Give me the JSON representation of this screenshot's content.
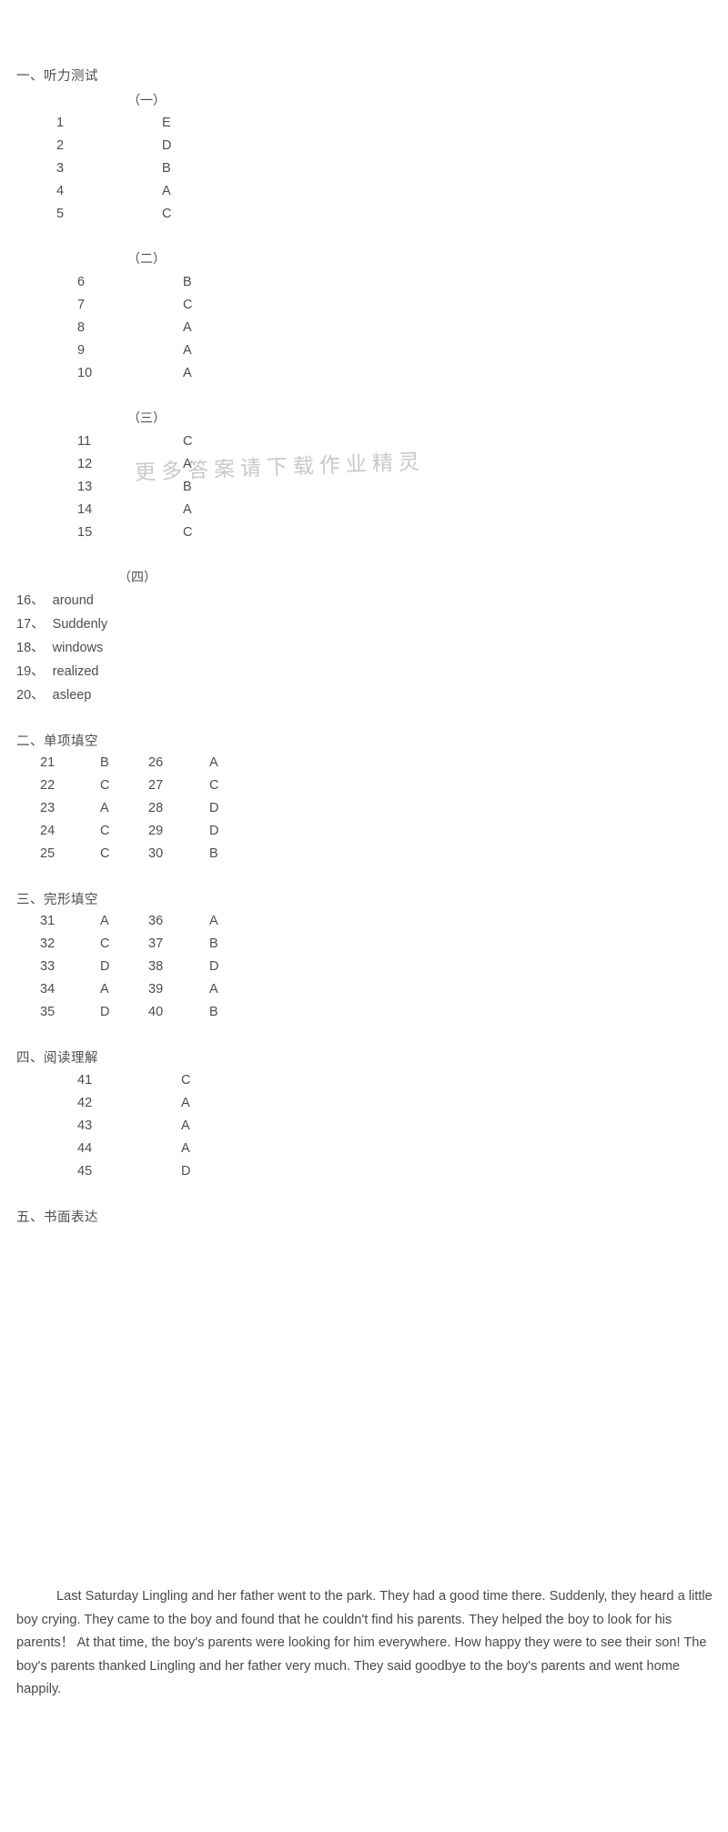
{
  "watermark": {
    "text": "更多答案请下载作业精灵"
  },
  "sections": {
    "one": {
      "heading": "一、听力测试",
      "groups": [
        {
          "header": "（一）",
          "items": [
            {
              "num": "1",
              "ans": "E"
            },
            {
              "num": "2",
              "ans": "D"
            },
            {
              "num": "3",
              "ans": "B"
            },
            {
              "num": "4",
              "ans": "A"
            },
            {
              "num": "5",
              "ans": "C"
            }
          ]
        },
        {
          "header": "（二）",
          "items": [
            {
              "num": "6",
              "ans": "B"
            },
            {
              "num": "7",
              "ans": "C"
            },
            {
              "num": "8",
              "ans": "A"
            },
            {
              "num": "9",
              "ans": "A"
            },
            {
              "num": "10",
              "ans": "A"
            }
          ]
        },
        {
          "header": "（三）",
          "items": [
            {
              "num": "11",
              "ans": "C"
            },
            {
              "num": "12",
              "ans": "A"
            },
            {
              "num": "13",
              "ans": "B"
            },
            {
              "num": "14",
              "ans": "A"
            },
            {
              "num": "15",
              "ans": "C"
            }
          ]
        },
        {
          "header": "（四）",
          "items": [
            {
              "num": "16、",
              "ans": "around"
            },
            {
              "num": "17、",
              "ans": "Suddenly"
            },
            {
              "num": "18、",
              "ans": "windows"
            },
            {
              "num": "19、",
              "ans": "realized"
            },
            {
              "num": "20、",
              "ans": "asleep"
            }
          ]
        }
      ]
    },
    "two": {
      "heading": "二、单项填空",
      "rows": [
        {
          "n1": "21",
          "v1": "B",
          "n2": "26",
          "v2": "A"
        },
        {
          "n1": "22",
          "v1": "C",
          "n2": "27",
          "v2": "C"
        },
        {
          "n1": "23",
          "v1": "A",
          "n2": "28",
          "v2": "D"
        },
        {
          "n1": "24",
          "v1": "C",
          "n2": "29",
          "v2": "D"
        },
        {
          "n1": "25",
          "v1": "C",
          "n2": "30",
          "v2": "B"
        }
      ]
    },
    "three": {
      "heading": "三、完形填空",
      "rows": [
        {
          "n1": "31",
          "v1": "A",
          "n2": "36",
          "v2": "A"
        },
        {
          "n1": "32",
          "v1": "C",
          "n2": "37",
          "v2": "B"
        },
        {
          "n1": "33",
          "v1": "D",
          "n2": "38",
          "v2": "D"
        },
        {
          "n1": "34",
          "v1": "A",
          "n2": "39",
          "v2": "A"
        },
        {
          "n1": "35",
          "v1": "D",
          "n2": "40",
          "v2": "B"
        }
      ]
    },
    "four": {
      "heading": "四、阅读理解",
      "items": [
        {
          "num": "41",
          "ans": "C"
        },
        {
          "num": "42",
          "ans": "A"
        },
        {
          "num": "43",
          "ans": "A"
        },
        {
          "num": "44",
          "ans": "A"
        },
        {
          "num": "45",
          "ans": "D"
        }
      ]
    },
    "five": {
      "heading": "五、书面表达",
      "body": "Last Saturday Lingling and her father went to the park. They had a good time there. Suddenly, they heard a little boy crying. They came to the boy and found that he couldn't find his parents. They helped the boy to look for his parents！ At that time, the boy's parents were looking for him everywhere. How happy they were to see their son! The boy's parents thanked Lingling and her father very much. They said goodbye to the boy's parents and went home happily."
    }
  }
}
